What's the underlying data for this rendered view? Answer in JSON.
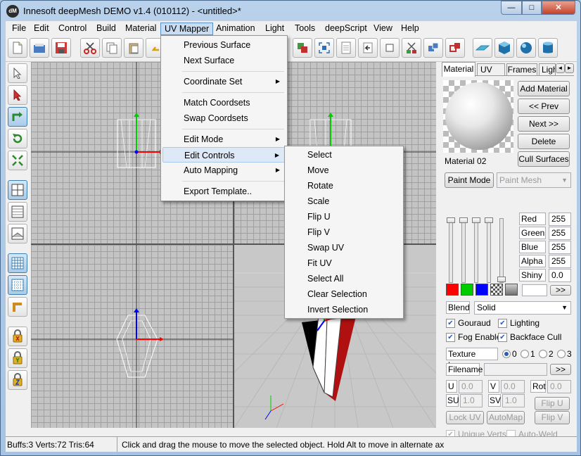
{
  "window": {
    "icon_text": "dM",
    "title": "Innesoft deepMesh DEMO v1.4 (010112) - <untitled>*",
    "min_glyph": "—",
    "max_glyph": "□",
    "close_glyph": "✕"
  },
  "menubar": [
    "File",
    "Edit",
    "Control",
    "Build",
    "Material",
    "UV Mapper",
    "Animation",
    "Light",
    "Tools",
    "deepScript",
    "View",
    "Help"
  ],
  "uv_menu": {
    "items": [
      "Previous Surface",
      "Next Surface",
      "Coordinate Set",
      "Match Coordsets",
      "Swap Coordsets",
      "Edit Mode",
      "Edit Controls",
      "Auto Mapping",
      "Export Template.."
    ],
    "arrow": "▶"
  },
  "edit_controls_menu": {
    "items": [
      "Select",
      "Move",
      "Rotate",
      "Scale",
      "Flip U",
      "Flip V",
      "Swap UV",
      "Fit UV",
      "Select All",
      "Clear Selection",
      "Invert Selection"
    ]
  },
  "toolbar": {
    "icons": [
      "new-file-icon",
      "open-icon",
      "save-icon",
      "cut-icon",
      "copy-icon",
      "paste-icon",
      "undo-icon",
      "layers-icon",
      "fit-view-icon",
      "document-icon",
      "import-icon",
      "square-icon",
      "cut-mesh-icon",
      "move-icon",
      "copy-mesh-icon",
      "plane-icon",
      "cube-icon",
      "sphere-icon",
      "cylinder-icon"
    ]
  },
  "left_toolbar": {
    "icons": [
      "pointer-icon",
      "select-arrow-icon",
      "move-tool-icon",
      "rotate-tool-icon",
      "scale-tool-icon",
      "quad-view-icon",
      "front-view-icon",
      "side-view-icon",
      "grid-icon",
      "dot-grid-icon",
      "edge-icon",
      "lock-x-icon",
      "lock-y-icon",
      "lock-z-icon"
    ]
  },
  "right_panel": {
    "tabs": [
      "Material",
      "UV",
      "Frames",
      "Ligh"
    ],
    "tab_arrows": [
      "◄",
      "►"
    ],
    "material_buttons": [
      "Add Material",
      "<< Prev",
      "Next >>",
      "Delete",
      "Cull Surfaces"
    ],
    "material_name": "Material 02",
    "paint_mode_button": "Paint Mode",
    "paint_select": "Paint Mesh",
    "channels": [
      {
        "label": "Red",
        "value": "255"
      },
      {
        "label": "Green",
        "value": "255"
      },
      {
        "label": "Blue",
        "value": "255"
      },
      {
        "label": "Alpha",
        "value": "255"
      },
      {
        "label": "Shiny",
        "value": "0.0"
      }
    ],
    "swatch_colors": [
      "#ff0000",
      "#00cc00",
      "#0000ff",
      "#8a8a8a",
      "#9a9a9a"
    ],
    "color_more_button": ">>",
    "blend_label": "Blend",
    "blend_value": "Solid",
    "checks": [
      {
        "label": "Gouraud",
        "checked": true
      },
      {
        "label": "Lighting",
        "checked": true
      },
      {
        "label": "Fog Enable",
        "checked": true
      },
      {
        "label": "Backface Cull",
        "checked": true
      }
    ],
    "texture_layer_label": "Texture Layer",
    "layer_options": [
      "0",
      "1",
      "2",
      "3"
    ],
    "filename_label": "Filename",
    "filename_button": ">>",
    "uv_fields": [
      {
        "label": "U",
        "value": "0.0"
      },
      {
        "label": "V",
        "value": "0.0"
      },
      {
        "label": "Rot",
        "value": "0.0"
      },
      {
        "label": "SU",
        "value": "1.0"
      },
      {
        "label": "SV",
        "value": "1.0"
      }
    ],
    "flip_u_button": "Flip U",
    "flip_v_button": "Flip V",
    "lock_uv_button": "Lock UV",
    "automap_button": "AutoMap",
    "unique_verts_label": "Unique Verts",
    "auto_weld_label": "Auto-Weld"
  },
  "status": {
    "counts": "Buffs:3 Verts:72 Tris:64",
    "hint": "Click and drag the mouse to move the selected object. Hold Alt to move in alternate ax"
  },
  "colors": {
    "titlebar": "#b9d1ea",
    "menu_highlight": "#c8dcf2",
    "viewport_bg": "#c4c4c4",
    "axis_x": "#ff0000",
    "axis_y": "#00cc00",
    "axis_z": "#0000ff"
  }
}
